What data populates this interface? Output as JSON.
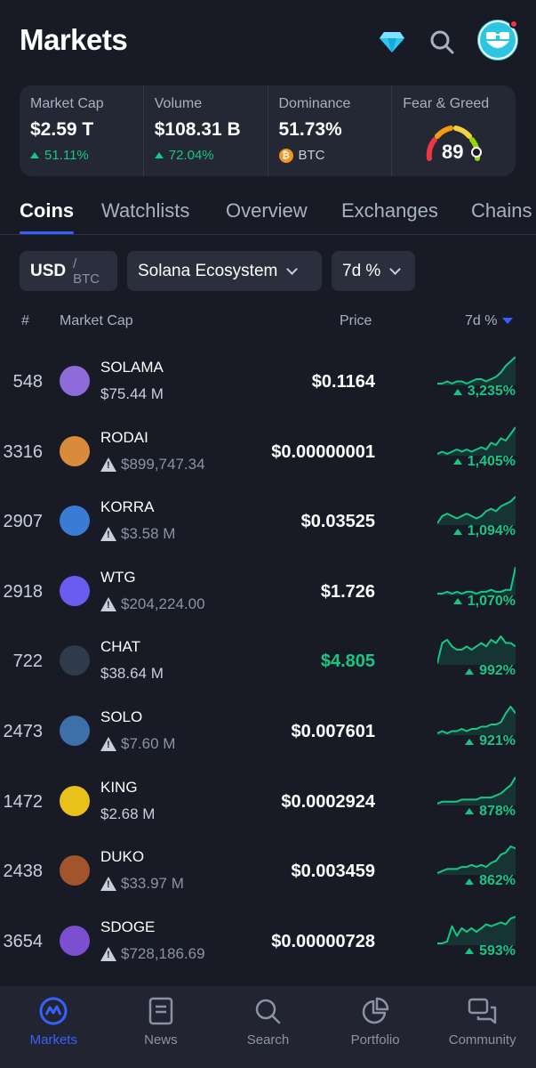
{
  "header": {
    "title": "Markets"
  },
  "stats": {
    "market_cap": {
      "label": "Market Cap",
      "value": "$2.59 T",
      "change": "51.11%"
    },
    "volume": {
      "label": "Volume",
      "value": "$108.31 B",
      "change": "72.04%"
    },
    "dominance": {
      "label": "Dominance",
      "value": "51.73%",
      "asset": "BTC",
      "asset_glyph": "₿"
    },
    "fear_greed": {
      "label": "Fear & Greed",
      "value": "89",
      "level": 0.89
    }
  },
  "tabs": [
    {
      "label": "Coins",
      "active": true
    },
    {
      "label": "Watchlists"
    },
    {
      "label": "Overview"
    },
    {
      "label": "Exchanges"
    },
    {
      "label": "Chains"
    }
  ],
  "filters": {
    "currency": "USD",
    "currency_alt": "/ BTC",
    "category": "Solana Ecosystem",
    "period": "7d %"
  },
  "columns": {
    "rank": "#",
    "market_cap": "Market Cap",
    "price": "Price",
    "change": "7d %"
  },
  "coins": [
    {
      "rank": "548",
      "symbol": "SOLAMA",
      "mcap": "$75.44 M",
      "warn": false,
      "price": "$0.1164",
      "change": "3,235%",
      "logo_color": "#8e6bd8",
      "spark": [
        4,
        4,
        5,
        4,
        5,
        5,
        4,
        5,
        6,
        6,
        5,
        6,
        7,
        9,
        12,
        14,
        16
      ]
    },
    {
      "rank": "3316",
      "symbol": "RODAI",
      "mcap": "$899,747.34",
      "warn": true,
      "price": "$0.00000001",
      "change": "1,405%",
      "logo_color": "#d98a3a",
      "spark": [
        4,
        5,
        4,
        5,
        6,
        5,
        6,
        5,
        6,
        7,
        6,
        9,
        8,
        11,
        10,
        13,
        16
      ]
    },
    {
      "rank": "2907",
      "symbol": "KORRA",
      "mcap": "$3.58 M",
      "warn": true,
      "price": "$0.03525",
      "change": "1,094%",
      "logo_color": "#3a7bd5",
      "spark": [
        6,
        9,
        10,
        9,
        8,
        9,
        10,
        9,
        8,
        9,
        11,
        12,
        11,
        13,
        14,
        15,
        17
      ]
    },
    {
      "rank": "2918",
      "symbol": "WTG",
      "mcap": "$204,224.00",
      "warn": true,
      "price": "$1.726",
      "change": "1,070%",
      "logo_color": "#6a5cf0",
      "spark": [
        4,
        4,
        5,
        4,
        5,
        4,
        5,
        5,
        4,
        5,
        5,
        6,
        5,
        5,
        6,
        6,
        18
      ]
    },
    {
      "rank": "722",
      "symbol": "CHAT",
      "mcap": "$38.64 M",
      "warn": false,
      "price": "$4.805",
      "change": "992%",
      "price_green": true,
      "logo_color": "#2f3b4a",
      "spark": [
        8,
        14,
        15,
        13,
        12,
        12,
        13,
        12,
        13,
        14,
        13,
        15,
        14,
        16,
        14,
        14,
        13
      ]
    },
    {
      "rank": "2473",
      "symbol": "SOLO",
      "mcap": "$7.60 M",
      "warn": true,
      "price": "$0.007601",
      "change": "921%",
      "logo_color": "#3d6fa8",
      "spark": [
        5,
        6,
        5,
        6,
        6,
        7,
        6,
        7,
        7,
        8,
        8,
        9,
        9,
        10,
        14,
        17,
        14
      ]
    },
    {
      "rank": "1472",
      "symbol": "KING",
      "mcap": "$2.68 M",
      "warn": false,
      "price": "$0.0002924",
      "change": "878%",
      "logo_color": "#e8c21a",
      "spark": [
        4,
        5,
        5,
        5,
        5,
        6,
        6,
        6,
        6,
        7,
        7,
        7,
        8,
        9,
        11,
        13,
        17
      ]
    },
    {
      "rank": "2438",
      "symbol": "DUKO",
      "mcap": "$33.97 M",
      "warn": true,
      "price": "$0.003459",
      "change": "862%",
      "logo_color": "#a2542d",
      "spark": [
        4,
        5,
        6,
        6,
        6,
        7,
        7,
        8,
        7,
        8,
        7,
        9,
        10,
        13,
        14,
        17,
        16
      ]
    },
    {
      "rank": "3654",
      "symbol": "SDOGE",
      "mcap": "$728,186.69",
      "warn": true,
      "price": "$0.00000728",
      "change": "593%",
      "logo_color": "#7b4fd0",
      "spark": [
        4,
        4,
        5,
        13,
        8,
        12,
        10,
        12,
        10,
        12,
        14,
        13,
        14,
        15,
        14,
        17,
        18
      ]
    }
  ],
  "nav": [
    {
      "label": "Markets",
      "icon": "markets-icon",
      "active": true
    },
    {
      "label": "News",
      "icon": "news-icon"
    },
    {
      "label": "Search",
      "icon": "search-icon"
    },
    {
      "label": "Portfolio",
      "icon": "portfolio-icon"
    },
    {
      "label": "Community",
      "icon": "community-icon"
    }
  ],
  "colors": {
    "background": "#181b26",
    "card": "#242835",
    "positive": "#16c784",
    "accent": "#3861fb"
  }
}
